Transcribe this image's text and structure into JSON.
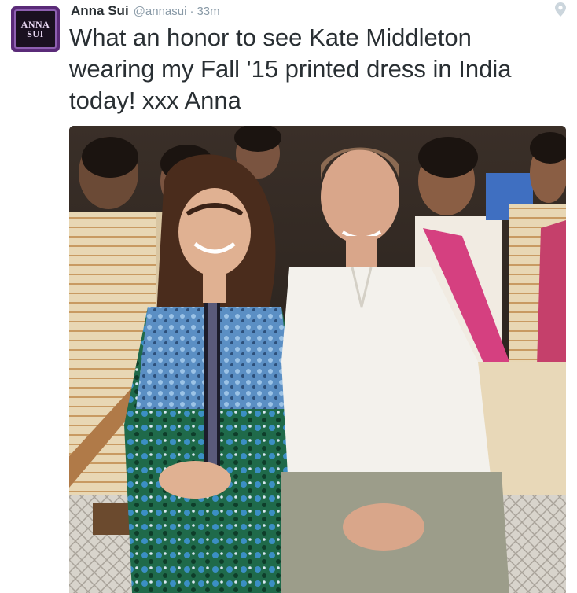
{
  "avatar": {
    "line1": "ANNA",
    "line2": "SUI"
  },
  "author": {
    "name": "Anna Sui",
    "handle": "@annasui",
    "separator": "·",
    "time": "33m"
  },
  "tweet": {
    "text": "What an honor to see Kate Middleton wearing my Fall '15 printed dress in India today! xxx Anna"
  },
  "icons": {
    "location": "map-pin-icon"
  },
  "colors": {
    "text": "#292f33",
    "muted": "#8899a6",
    "avatar_bg": "#5a2a78"
  }
}
